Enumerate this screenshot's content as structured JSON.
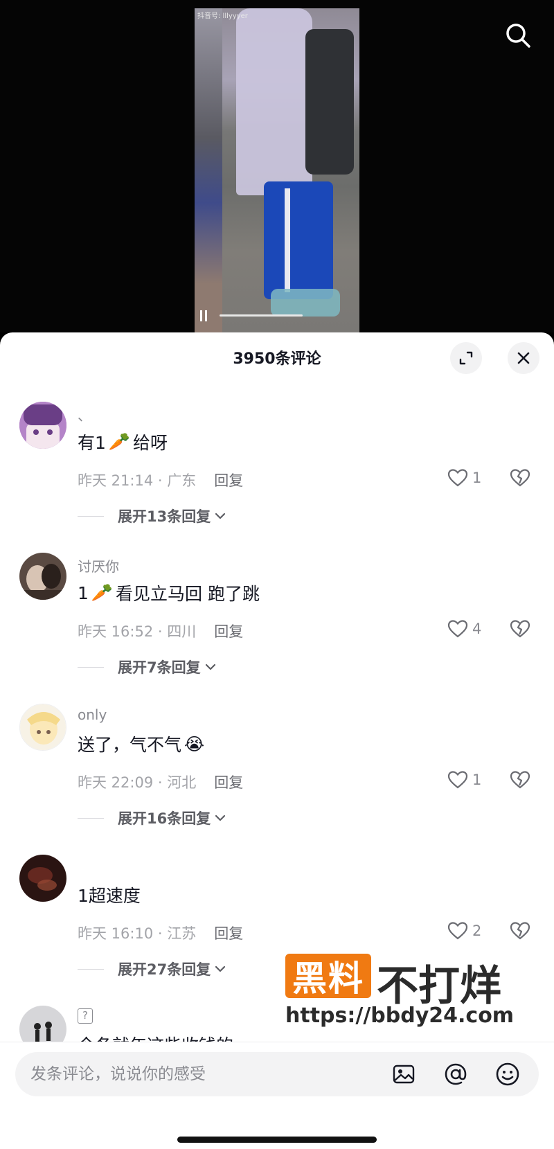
{
  "video": {
    "watermark_tag": "抖音号: lllyyyer"
  },
  "sheet": {
    "title": "3950条评论"
  },
  "comments": [
    {
      "username": "、",
      "text": "有1",
      "emoji": "🥕",
      "text_after": "给呀",
      "time_location": "昨天 21:14 · 广东",
      "reply_label": "回复",
      "likes": "1",
      "expand_label": "展开13条回复",
      "avatar_color": "#b07ac4"
    },
    {
      "username": "讨厌你",
      "text": "1",
      "emoji": "🥕",
      "text_after": " 看见立马回 跑了跳",
      "time_location": "昨天 16:52 · 四川",
      "reply_label": "回复",
      "likes": "4",
      "expand_label": "展开7条回复",
      "avatar_color": "#5a4a42"
    },
    {
      "username": "only",
      "text": "送了，气不气",
      "emoji": "😭",
      "text_after": "",
      "time_location": "昨天 22:09 · 河北",
      "reply_label": "回复",
      "likes": "1",
      "expand_label": "展开16条回复",
      "avatar_color": "#f1ead8"
    },
    {
      "username": "",
      "text": "1超速度",
      "emoji": "",
      "text_after": "",
      "time_location": "昨天 16:10 · 江苏",
      "reply_label": "回复",
      "likes": "2",
      "expand_label": "展开27条回复",
      "avatar_color": "#3a1e1a"
    },
    {
      "username": "?",
      "text": "今冬就年这些收钱的",
      "emoji": "",
      "text_after": "",
      "avatar_color": "#cfcfd2"
    }
  ],
  "watermark": {
    "badge": "黑料",
    "rest": "不打烊",
    "url": "https://bbdy24.com"
  },
  "input": {
    "placeholder": "发条评论，说说你的感受"
  },
  "icons": {
    "search": "search-icon",
    "expand": "expand-icon",
    "close": "close-icon",
    "heart": "heart-icon",
    "dislike": "broken-heart-icon",
    "chevron": "chevron-down-icon",
    "image": "image-icon",
    "mention": "at-icon",
    "emoji": "smiley-icon"
  },
  "colors": {
    "watermark_orange": "#f07a12",
    "text_primary": "#161823",
    "text_secondary": "#a3a4a9"
  }
}
